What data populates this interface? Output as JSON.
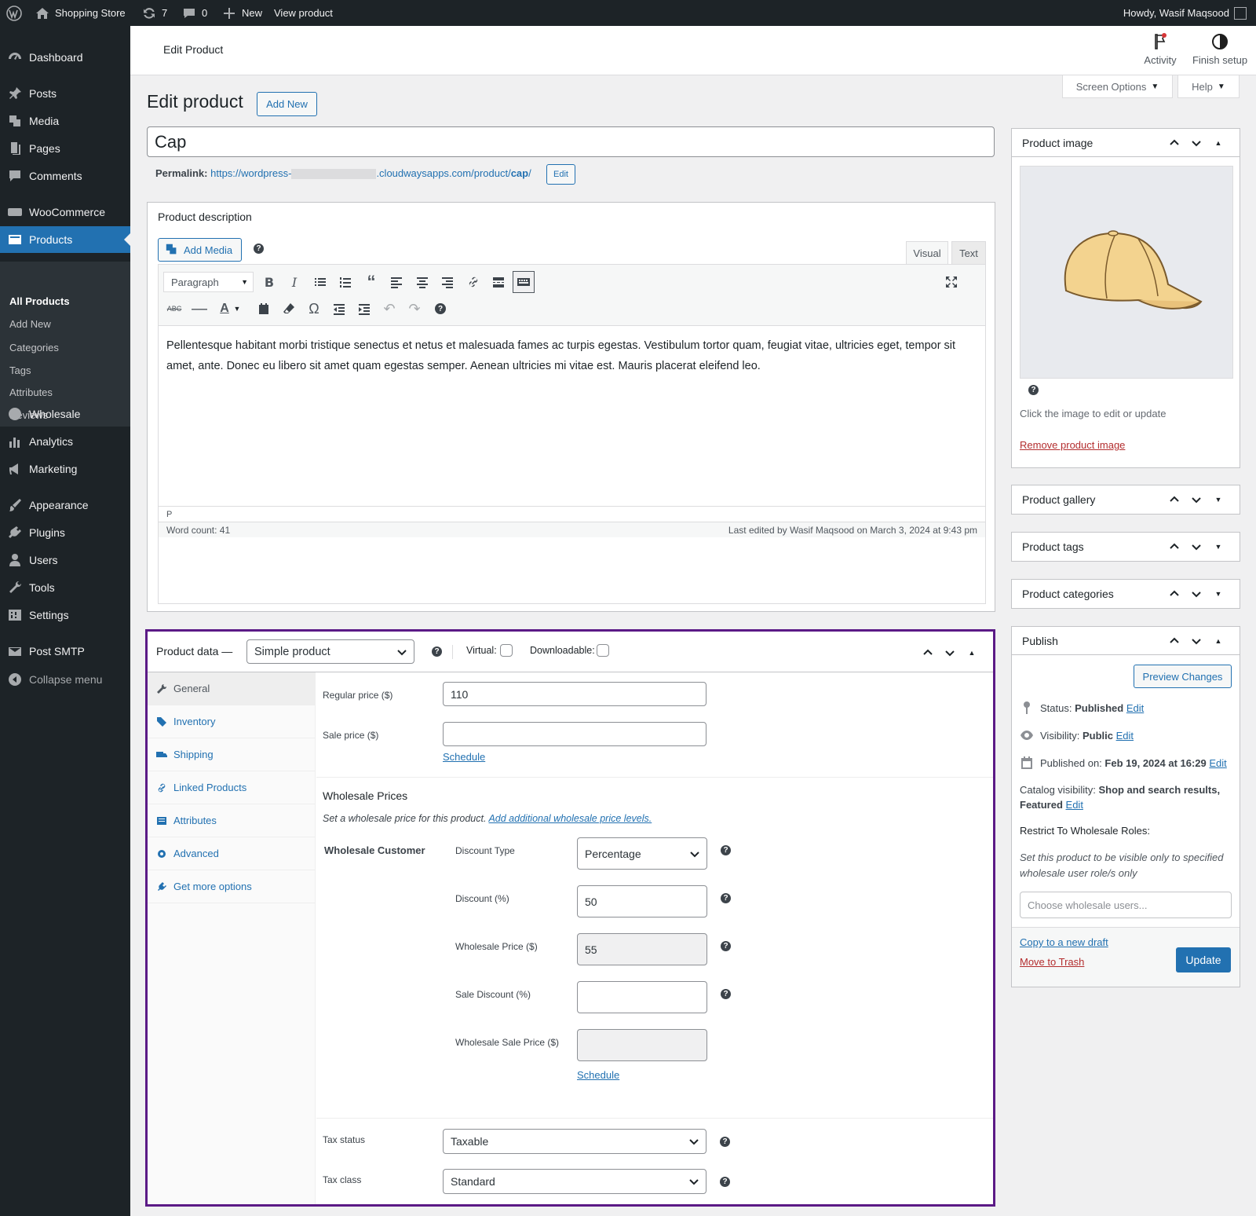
{
  "adminbar": {
    "site_name": "Shopping Store",
    "updates_count": "7",
    "comments_count": "0",
    "new_label": "New",
    "view_label": "View product",
    "howdy": "Howdy, Wasif Maqsood"
  },
  "sidebar": {
    "items": [
      {
        "label": "Dashboard",
        "icon": "dashboard-icon"
      },
      {
        "label": "Posts",
        "icon": "pin-icon"
      },
      {
        "label": "Media",
        "icon": "media-icon"
      },
      {
        "label": "Pages",
        "icon": "pages-icon"
      },
      {
        "label": "Comments",
        "icon": "comments-icon"
      },
      {
        "label": "WooCommerce",
        "icon": "woo-icon"
      },
      {
        "label": "Products",
        "icon": "products-icon"
      },
      {
        "label": "Wholesale",
        "icon": "wholesale-icon"
      },
      {
        "label": "Analytics",
        "icon": "analytics-icon"
      },
      {
        "label": "Marketing",
        "icon": "megaphone-icon"
      },
      {
        "label": "Appearance",
        "icon": "brush-icon"
      },
      {
        "label": "Plugins",
        "icon": "plugins-icon"
      },
      {
        "label": "Users",
        "icon": "users-icon"
      },
      {
        "label": "Tools",
        "icon": "tools-icon"
      },
      {
        "label": "Settings",
        "icon": "settings-icon"
      },
      {
        "label": "Post SMTP",
        "icon": "mail-icon"
      },
      {
        "label": "Collapse menu",
        "icon": "collapse-icon"
      }
    ],
    "submenu": [
      "All Products",
      "Add New",
      "Categories",
      "Tags",
      "Attributes",
      "Reviews"
    ]
  },
  "header": {
    "title": "Edit Product",
    "activity": "Activity",
    "finish_setup": "Finish setup",
    "screen_options": "Screen Options",
    "help": "Help"
  },
  "page": {
    "title": "Edit product",
    "add_new": "Add New",
    "product_title": "Cap",
    "permalink_label": "Permalink:",
    "permalink_url_start": "https://wordpress-",
    "permalink_url_end": ".cloudwaysapps.com/product/",
    "permalink_slug": "cap",
    "permalink_trail": "/",
    "permalink_edit": "Edit"
  },
  "description": {
    "heading": "Product description",
    "add_media": "Add Media",
    "tab_visual": "Visual",
    "tab_text": "Text",
    "format": "Paragraph",
    "content": "Pellentesque habitant morbi tristique senectus et netus et malesuada fames ac turpis egestas. Vestibulum tortor quam, feugiat vitae, ultricies eget, tempor sit amet, ante. Donec eu libero sit amet quam egestas semper. Aenean ultricies mi vitae est. Mauris placerat eleifend leo.",
    "path": "P",
    "word_count": "Word count: 41",
    "last_edited": "Last edited by Wasif Maqsood on March 3, 2024 at 9:43 pm"
  },
  "product_data": {
    "heading": "Product data —",
    "type": "Simple product",
    "virtual_label": "Virtual:",
    "downloadable_label": "Downloadable:",
    "tabs": [
      "General",
      "Inventory",
      "Shipping",
      "Linked Products",
      "Attributes",
      "Advanced",
      "Get more options"
    ],
    "regular_price_label": "Regular price ($)",
    "regular_price": "110",
    "sale_price_label": "Sale price ($)",
    "sale_price": "",
    "schedule": "Schedule",
    "wholesale_heading": "Wholesale Prices",
    "wholesale_desc": "Set a wholesale price for this product.",
    "wholesale_link": "Add additional wholesale price levels.",
    "wholesale_role": "Wholesale Customer",
    "discount_type_label": "Discount Type",
    "discount_type": "Percentage",
    "discount_label": "Discount (%)",
    "discount": "50",
    "wholesale_price_label": "Wholesale Price ($)",
    "wholesale_price": "55",
    "sale_discount_label": "Sale Discount (%)",
    "wholesale_sale_price_label": "Wholesale Sale Price ($)",
    "tax_status_label": "Tax status",
    "tax_status": "Taxable",
    "tax_class_label": "Tax class",
    "tax_class": "Standard"
  },
  "product_image": {
    "heading": "Product image",
    "hint": "Click the image to edit or update",
    "remove": "Remove product image"
  },
  "panels": {
    "gallery": "Product gallery",
    "tags": "Product tags",
    "categories": "Product categories"
  },
  "publish": {
    "heading": "Publish",
    "preview": "Preview Changes",
    "status_label": "Status:",
    "status": "Published",
    "visibility_label": "Visibility:",
    "visibility": "Public",
    "published_label": "Published on:",
    "published": "Feb 19, 2024 at 16:29",
    "edit": "Edit",
    "catalog_label": "Catalog visibility:",
    "catalog": "Shop and search results, Featured",
    "restrict_heading": "Restrict To Wholesale Roles:",
    "restrict_desc": "Set this product to be visible only to specified wholesale user role/s only",
    "restrict_placeholder": "Choose wholesale users...",
    "copy_draft": "Copy to a new draft",
    "trash": "Move to Trash",
    "update": "Update"
  },
  "colors": {
    "accent": "#2271b1",
    "sidebar": "#1d2327",
    "highlight_border": "#5b1a86",
    "trash": "#b32d2e"
  }
}
